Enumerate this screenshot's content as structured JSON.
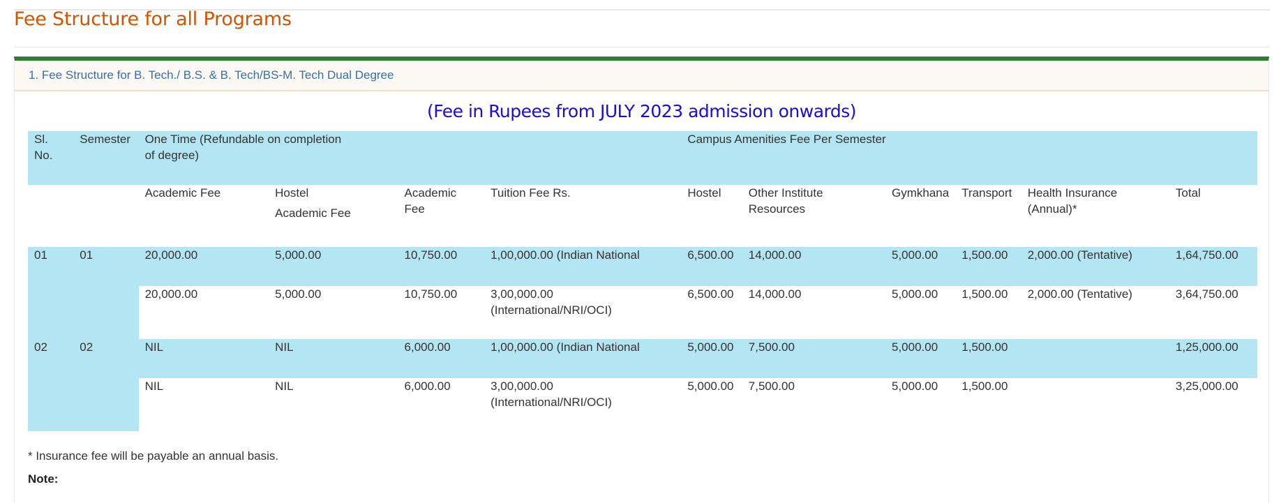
{
  "page": {
    "title": "Fee Structure for all Programs"
  },
  "panel": {
    "heading": "1. Fee Structure for B. Tech./ B.S. & B. Tech/BS-M. Tech Dual Degree",
    "caption": "(Fee in Rupees from JULY 2023 admission onwards)"
  },
  "table": {
    "header1": {
      "sl_no": "Sl. No.",
      "semester": "Semester",
      "one_time": "One Time (Refundable on completion of degree)",
      "campus_amenities": "Campus Amenities Fee Per Semester"
    },
    "header2": {
      "academic_fee": "Academic Fee",
      "hostel_line1": "Hostel",
      "hostel_line2": "Academic Fee",
      "academic_fee2": "Academic Fee",
      "tuition_fee": "Tuition Fee Rs.",
      "hostel": "Hostel",
      "other_resources": "Other Institute Resources",
      "gymkhana": "Gymkhana",
      "transport": "Transport",
      "health_insurance": "Health Insurance (Annual)*",
      "total": "Total"
    },
    "rows": [
      {
        "sl": "01",
        "sem": "01",
        "academic": "20,000.00",
        "hostel_academic": "5,000.00",
        "academic2": "10,750.00",
        "tuition": "1,00,000.00 (Indian National",
        "hostel": "6,500.00",
        "other": "14,000.00",
        "gymkhana": "5,000.00",
        "transport": "1,500.00",
        "health": "2,000.00 (Tentative)",
        "total": "1,64,750.00"
      },
      {
        "academic": "20,000.00",
        "hostel_academic": "5,000.00",
        "academic2": "10,750.00",
        "tuition": "3,00,000.00 (International/NRI/OCI)",
        "hostel": "6,500.00",
        "other": "14,000.00",
        "gymkhana": "5,000.00",
        "transport": "1,500.00",
        "health": "2,000.00 (Tentative)",
        "total": "3,64,750.00"
      },
      {
        "sl": "02",
        "sem": "02",
        "academic": "NIL",
        "hostel_academic": "NIL",
        "academic2": "6,000.00",
        "tuition": "1,00,000.00 (Indian National",
        "hostel": "5,000.00",
        "other": "7,500.00",
        "gymkhana": "5,000.00",
        "transport": "1,500.00",
        "health": "",
        "total": "1,25,000.00"
      },
      {
        "academic": "NIL",
        "hostel_academic": "NIL",
        "academic2": "6,000.00",
        "tuition": "3,00,000.00 (International/NRI/OCI)",
        "hostel": "5,000.00",
        "other": "7,500.00",
        "gymkhana": "5,000.00",
        "transport": "1,500.00",
        "health": "",
        "total": "3,25,000.00"
      }
    ]
  },
  "footnote": "* Insurance fee will be payable an annual basis.",
  "note_label": "Note:",
  "colors": {
    "title": "#d35400",
    "caption": "#1a0dd6",
    "panel_accent": "#2e7d32",
    "row_highlight": "#b3e5f3",
    "link": "#3a6fa5"
  }
}
